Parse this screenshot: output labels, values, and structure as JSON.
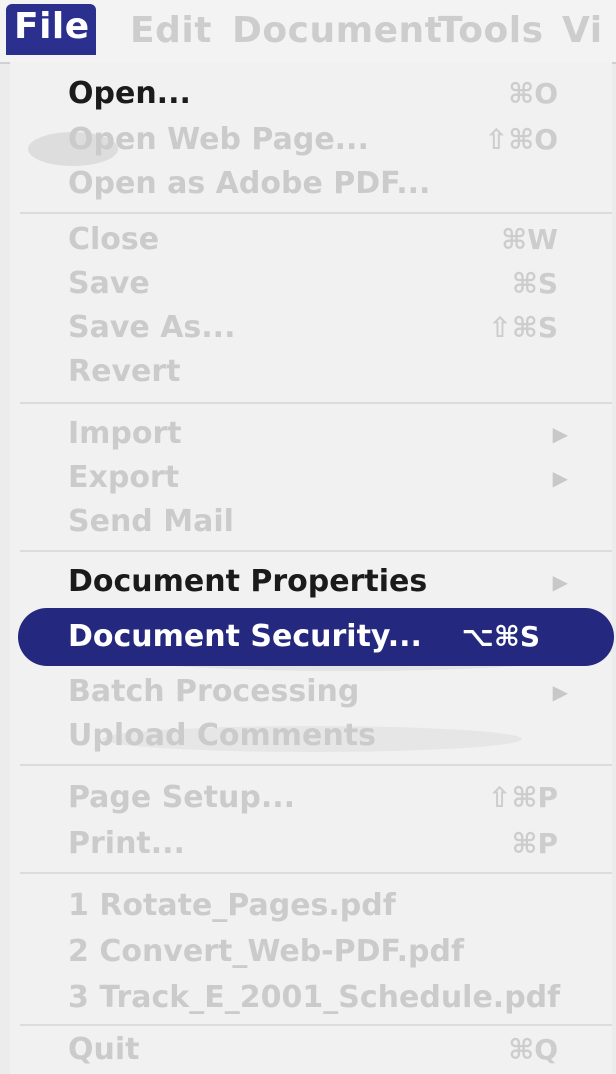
{
  "menubar": {
    "items": [
      "File",
      "Edit",
      "Document",
      "Tools",
      "Vi"
    ]
  },
  "menu": {
    "open": "Open...",
    "open_sc": "⌘O",
    "open_web": "Open Web Page...",
    "open_web_sc": "⇧⌘O",
    "open_as_pdf": "Open as Adobe PDF...",
    "close": "Close",
    "close_sc": "⌘W",
    "save": "Save",
    "save_sc": "⌘S",
    "save_as": "Save As...",
    "save_as_sc": "⇧⌘S",
    "revert": "Revert",
    "import": "Import",
    "export": "Export",
    "send_mail": "Send Mail",
    "doc_properties": "Document Properties",
    "doc_security": "Document Security...",
    "doc_security_sc": "⌥⌘S",
    "batch": "Batch Processing",
    "upload": "Upload Comments",
    "page_setup": "Page Setup...",
    "page_setup_sc": "⇧⌘P",
    "print": "Print...",
    "print_sc": "⌘P",
    "recent1": "1 Rotate_Pages.pdf",
    "recent2": "2 Convert_Web-PDF.pdf",
    "recent3": "3 Track_E_2001_Schedule.pdf",
    "quit": "Quit",
    "quit_sc": "⌘Q",
    "submenu_arrow": "▶"
  },
  "colors": {
    "highlight": "#24297f",
    "menu_bg": "#f1f1f1",
    "disabled_text": "#cbcbcb"
  }
}
